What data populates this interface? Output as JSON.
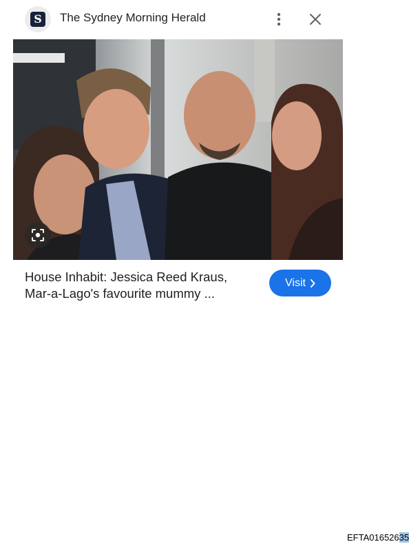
{
  "header": {
    "site_logo_letter": "S",
    "site_name": "The Sydney Morning Herald",
    "more_icon": "more-vert-icon",
    "close_icon": "close-icon"
  },
  "image": {
    "lens_icon": "lens-search-icon"
  },
  "result": {
    "title": "House Inhabit: Jessica Reed Kraus, Mar-a-Lago's favourite mummy ...",
    "visit_label": "Visit",
    "visit_icon": "chevron-right-icon"
  },
  "footer": {
    "doc_id_main": "EFTA016526",
    "doc_id_highlight": "35"
  },
  "colors": {
    "accent": "#1a73e8",
    "logo_tile": "#17223a"
  }
}
